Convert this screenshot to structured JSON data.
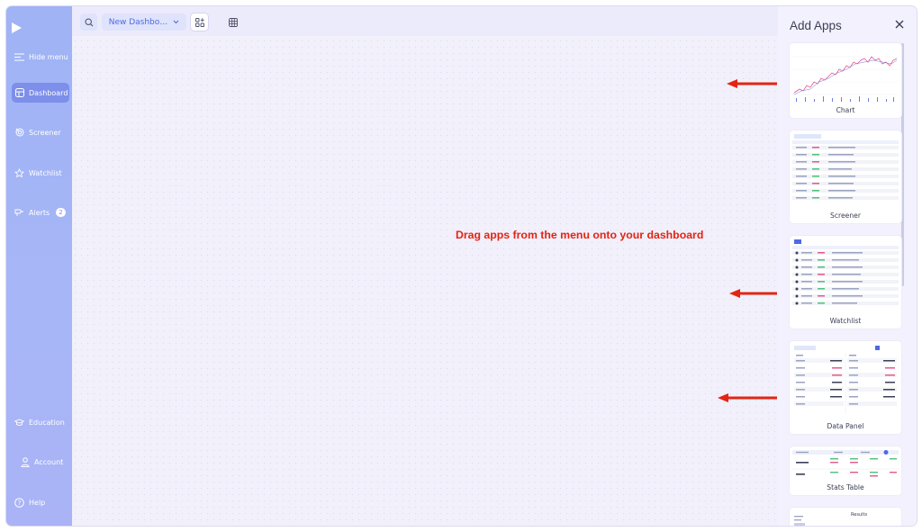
{
  "sidebar": {
    "hide_menu": "Hide menu",
    "items": [
      {
        "label": "Dashboard",
        "icon": "dashboard-icon"
      },
      {
        "label": "Screener",
        "icon": "screener-icon"
      },
      {
        "label": "Watchlist",
        "icon": "star-icon"
      },
      {
        "label": "Alerts",
        "icon": "alert-icon",
        "badge": "2"
      }
    ],
    "bottom_items": [
      {
        "label": "Education",
        "icon": "graduation-cap-icon"
      },
      {
        "label": "Account",
        "icon": "user-icon"
      },
      {
        "label": "Help",
        "icon": "help-icon"
      }
    ]
  },
  "topbar": {
    "dashboard_name": "New Dashbo…",
    "icons": [
      "search-icon",
      "chevron-down-icon",
      "apps-icon",
      "grid-layout-icon"
    ]
  },
  "main": {
    "hint": "Drag apps from the menu onto your dashboard"
  },
  "panel": {
    "title": "Add Apps",
    "apps": [
      {
        "label": "Chart"
      },
      {
        "label": "Screener"
      },
      {
        "label": "Watchlist"
      },
      {
        "label": "Data Panel"
      },
      {
        "label": "Stats Table"
      },
      {
        "label": ""
      }
    ],
    "partial_card_title": "Results"
  },
  "colors": {
    "sidebar": "#a3b5f6",
    "accent": "#4f68e6",
    "hint_red": "#e42412",
    "chart_line": "#e05a8c"
  }
}
